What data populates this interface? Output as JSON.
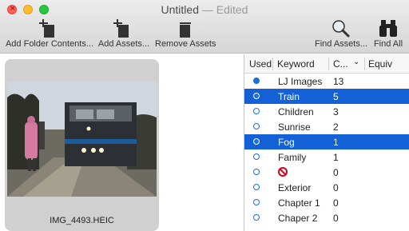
{
  "window": {
    "title": "Untitled",
    "edited": "— Edited"
  },
  "toolbar": {
    "add_folder_contents": "Add Folder Contents...",
    "add_assets": "Add Assets...",
    "remove_assets": "Remove Assets",
    "find_assets": "Find Assets...",
    "find_all": "Find All"
  },
  "asset": {
    "filename": "IMG_4493.HEIC"
  },
  "table": {
    "columns": {
      "used": "Used",
      "keyword": "Keyword",
      "count": "C...",
      "equiv": "Equiv"
    },
    "rows": [
      {
        "used": "filled",
        "keyword": "LJ Images",
        "count": "13",
        "selected": false
      },
      {
        "used": "filled",
        "keyword": "Train",
        "count": "5",
        "selected": true
      },
      {
        "used": "hollow",
        "keyword": "Children",
        "count": "3",
        "selected": false
      },
      {
        "used": "hollow",
        "keyword": "Sunrise",
        "count": "2",
        "selected": false
      },
      {
        "used": "filled",
        "keyword": "Fog",
        "count": "1",
        "selected": true
      },
      {
        "used": "hollow",
        "keyword": "Family",
        "count": "1",
        "selected": false
      },
      {
        "used": "hollow",
        "keyword": "",
        "icon": "no-entry-icon",
        "count": "0",
        "selected": false
      },
      {
        "used": "hollow",
        "keyword": "Exterior",
        "count": "0",
        "selected": false
      },
      {
        "used": "hollow",
        "keyword": "Chapter 1",
        "count": "0",
        "selected": false
      },
      {
        "used": "hollow",
        "keyword": "Chaper 2",
        "count": "0",
        "selected": false
      }
    ]
  },
  "colors": {
    "selection": "#1460d7",
    "used_dot": "#1a6fe2"
  }
}
